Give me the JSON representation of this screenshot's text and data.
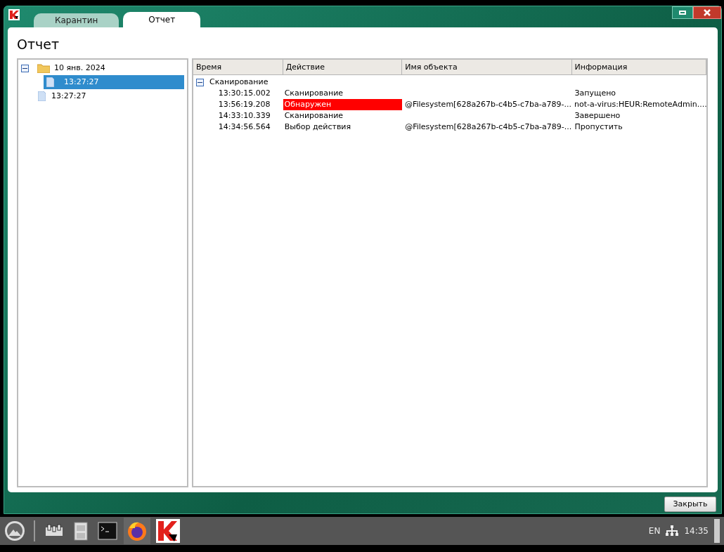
{
  "window": {
    "tabs": [
      {
        "label": "Карантин",
        "selected": false
      },
      {
        "label": "Отчет",
        "selected": true
      }
    ],
    "heading": "Отчет",
    "tree": [
      {
        "label": "10 янв. 2024",
        "kind": "folder",
        "expanded": true,
        "selected": false,
        "children": [
          {
            "label": "13:27:27",
            "kind": "file",
            "selected": true
          }
        ]
      },
      {
        "label": "13:27:27",
        "kind": "file",
        "selected": false
      }
    ],
    "table": {
      "columns": [
        "Время",
        "Действие",
        "Имя объекта",
        "Информация"
      ],
      "group": {
        "label": "Сканирование",
        "expanded": true
      },
      "rows": [
        {
          "time": "13:30:15.002",
          "action": "Сканирование",
          "object": "",
          "info": "Запущено",
          "highlighted": false
        },
        {
          "time": "13:56:19.208",
          "action": "Обнаружен",
          "object": "@Filesystem[628a267b-c4b5-c7ba-a789-...",
          "info": "not-a-virus:HEUR:RemoteAdmin....",
          "highlighted": true
        },
        {
          "time": "14:33:10.339",
          "action": "Сканирование",
          "object": "",
          "info": "Завершено",
          "highlighted": false
        },
        {
          "time": "14:34:56.564",
          "action": "Выбор действия",
          "object": "@Filesystem[628a267b-c4b5-c7ba-a789-...",
          "info": "Пропустить",
          "highlighted": false
        }
      ]
    },
    "close_button": "Закрыть"
  },
  "taskbar": {
    "language": "EN",
    "clock": "14:35"
  }
}
